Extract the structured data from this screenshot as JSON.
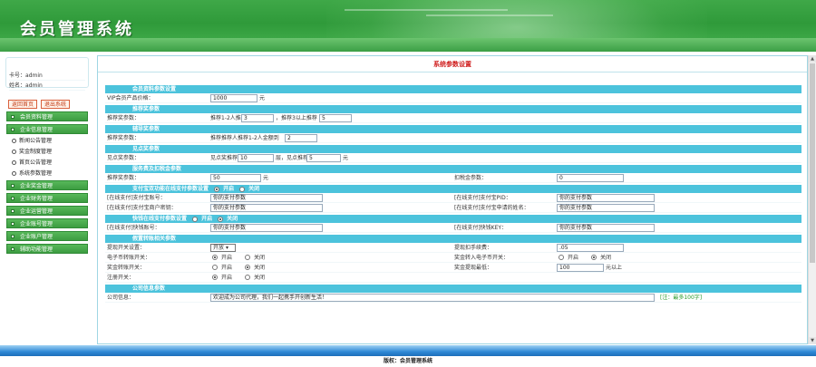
{
  "app_title": "会员管理系统",
  "user": {
    "card_label": "卡号：",
    "card_value": "admin",
    "name_label": "姓名：",
    "name_value": "admin"
  },
  "sidebar_buttons": {
    "home": "返回首页",
    "logout": "退出系统"
  },
  "nav": [
    {
      "label": "会员资料管理",
      "type": "section"
    },
    {
      "label": "企业信息管理",
      "type": "section"
    },
    {
      "label": "新闻公告管理",
      "type": "sub"
    },
    {
      "label": "奖金制度管理",
      "type": "sub"
    },
    {
      "label": "首页公告管理",
      "type": "sub"
    },
    {
      "label": "系统参数管理",
      "type": "sub"
    },
    {
      "label": "企业奖金管理",
      "type": "section"
    },
    {
      "label": "企业财务管理",
      "type": "section"
    },
    {
      "label": "企业运营管理",
      "type": "section"
    },
    {
      "label": "企业账号管理",
      "type": "section"
    },
    {
      "label": "企业账户管理",
      "type": "section"
    },
    {
      "label": "辅助功能管理",
      "type": "section"
    }
  ],
  "main": {
    "title": "系统参数设置",
    "sections": {
      "s1": "会员资料参数设置",
      "s2": "推荐奖参数",
      "s3": "辅导奖参数",
      "s4": "见点奖参数",
      "s5": "服务费及扣税金参数",
      "s6": "支付宝双功能在线支付参数设置",
      "s7": "快钱在线支付参数设置",
      "s8": "假置转账相关参数",
      "s9": "公司信息参数"
    },
    "fields": {
      "vip_label": "VIP会员产品价格：",
      "vip_value": "1000",
      "vip_unit": "元",
      "rec_label": "推荐奖参数：",
      "rec_t1": "推荐1-2人推荐",
      "rec_v1": "3",
      "rec_t2": "，推荐3以上推荐",
      "rec_v2": "5",
      "tut_label": "推荐奖参数：",
      "tut_t1": "推荐推荐人推荐1-2人金额到",
      "tut_v1": "2",
      "see_label": "见点奖参数：",
      "see_t1": "见点奖推荐",
      "see_v1": "10",
      "see_t2": "层，见点推荐",
      "see_v2": "5",
      "see_unit": "元",
      "fee_label": "推荐奖参数：",
      "fee_value": "50",
      "fee_unit": "元",
      "tax_label": "扣税金参数：",
      "tax_value": "0",
      "alipay_on": "开启",
      "alipay_off": "关闭",
      "alipay_account_label": "[在线支付]支付宝账号：",
      "alipay_account_value": "你的支付参数",
      "alipay_pid_label": "[在线支付]支付宝PID：",
      "alipay_pid_value": "你的支付参数",
      "alipay_key_label": "[在线支付]支付宝商户密钥：",
      "alipay_key_value": "你的支付参数",
      "alipay_name_label": "[在线支付]支付宝申请的姓名：",
      "alipay_name_value": "你的支付参数",
      "kq_on": "开启",
      "kq_off": "关闭",
      "kq_account_label": "[在线支付]快钱账号：",
      "kq_account_value": "你的支付参数",
      "kq_key_label": "[在线支付]快钱KEY：",
      "kq_key_value": "你的支付参数",
      "tr_switch_label": "提现开关设置：",
      "tr_switch_value": "开放",
      "tr_fee_label": "提现扣手续费：",
      "tr_fee_value": ".05",
      "ecoin_label": "电子币转账开关：",
      "ecoin_on": "开启",
      "ecoin_off": "关闭",
      "eb_label": "奖金转入电子币开关：",
      "eb_on": "开启",
      "eb_off": "关闭",
      "bonus_label": "奖金转账开关：",
      "bonus_on": "开启",
      "bonus_off": "关闭",
      "bmin_label": "奖金提现最低：",
      "bmin_value": "100",
      "bmin_unit": "元以上",
      "reg_label": "注册开关：",
      "reg_on": "开启",
      "reg_off": "关闭",
      "co_label": "公司信息：",
      "co_value": "欢迎成为公司代理，我们一起携手开创新生活！",
      "co_note": "[注：最多100字]"
    }
  },
  "footer": "版权：会员管理系统"
}
